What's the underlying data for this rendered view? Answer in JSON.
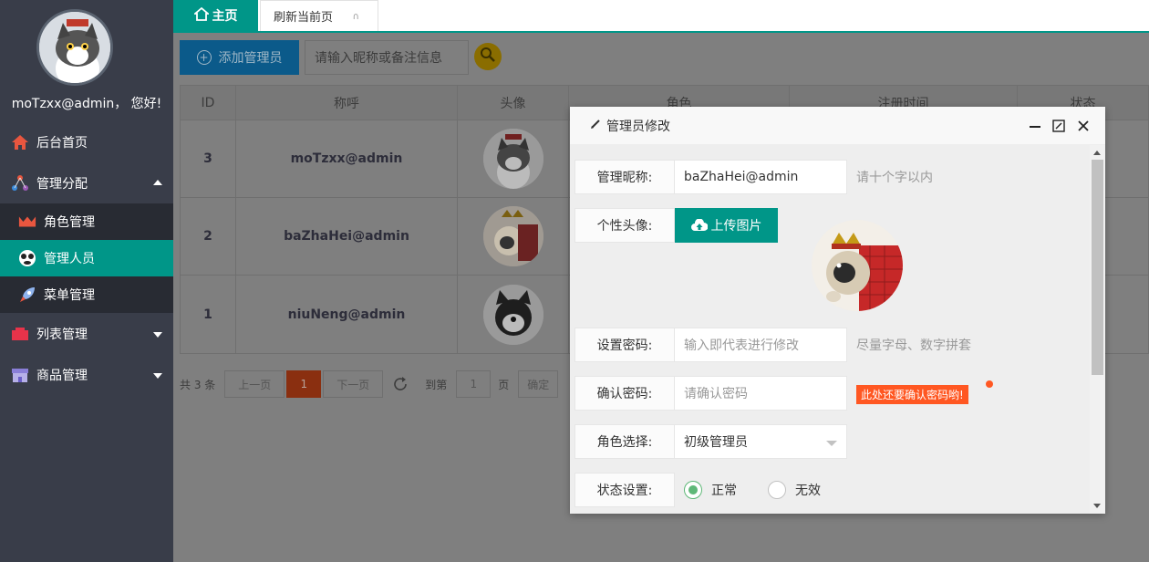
{
  "sidebar": {
    "greeting": "moTzxx@admin， 您好!",
    "items": [
      {
        "label": "后台首页",
        "icon": "home-icon"
      },
      {
        "label": "管理分配",
        "icon": "network-icon"
      },
      {
        "label": "列表管理",
        "icon": "list-icon"
      },
      {
        "label": "商品管理",
        "icon": "shop-icon"
      }
    ],
    "sub_items": [
      {
        "label": "角色管理",
        "icon": "role-icon"
      },
      {
        "label": "管理人员",
        "icon": "admin-icon"
      },
      {
        "label": "菜单管理",
        "icon": "rocket-icon"
      }
    ]
  },
  "tabs": {
    "home": "主页",
    "refresh": "刷新当前页",
    "refresh_close": "∩"
  },
  "toolbar": {
    "add_label": "添加管理员",
    "search_placeholder": "请输入昵称或备注信息"
  },
  "table": {
    "headers": [
      "ID",
      "称呼",
      "头像",
      "角色",
      "注册时间",
      "状态"
    ],
    "rows": [
      {
        "id": "3",
        "name": "moTzxx@admin"
      },
      {
        "id": "2",
        "name": "baZhaHei@admin"
      },
      {
        "id": "1",
        "name": "niuNeng@admin"
      }
    ]
  },
  "pager": {
    "total": "共 3 条",
    "prev": "上一页",
    "current": "1",
    "next": "下一页",
    "goto": "到第",
    "page_value": "1",
    "page_unit": "页",
    "confirm": "确定"
  },
  "dialog": {
    "title": "管理员修改",
    "fields": {
      "nickname_label": "管理昵称:",
      "nickname_value": "baZhaHei@admin",
      "nickname_hint": "请十个字以内",
      "avatar_label": "个性头像:",
      "upload_label": "上传图片",
      "password_label": "设置密码:",
      "password_placeholder": "输入即代表进行修改",
      "password_hint": "尽量字母、数字拼套",
      "confirm_label": "确认密码:",
      "confirm_placeholder": "请确认密码",
      "confirm_warning": "此处还要确认密码哟!",
      "role_label": "角色选择:",
      "role_value": "初级管理员",
      "status_label": "状态设置:",
      "status_normal": "正常",
      "status_invalid": "无效"
    }
  },
  "colors": {
    "accent": "#009688",
    "sidebar": "#393d49",
    "warning": "#ff5722",
    "radio": "#5fb878"
  }
}
